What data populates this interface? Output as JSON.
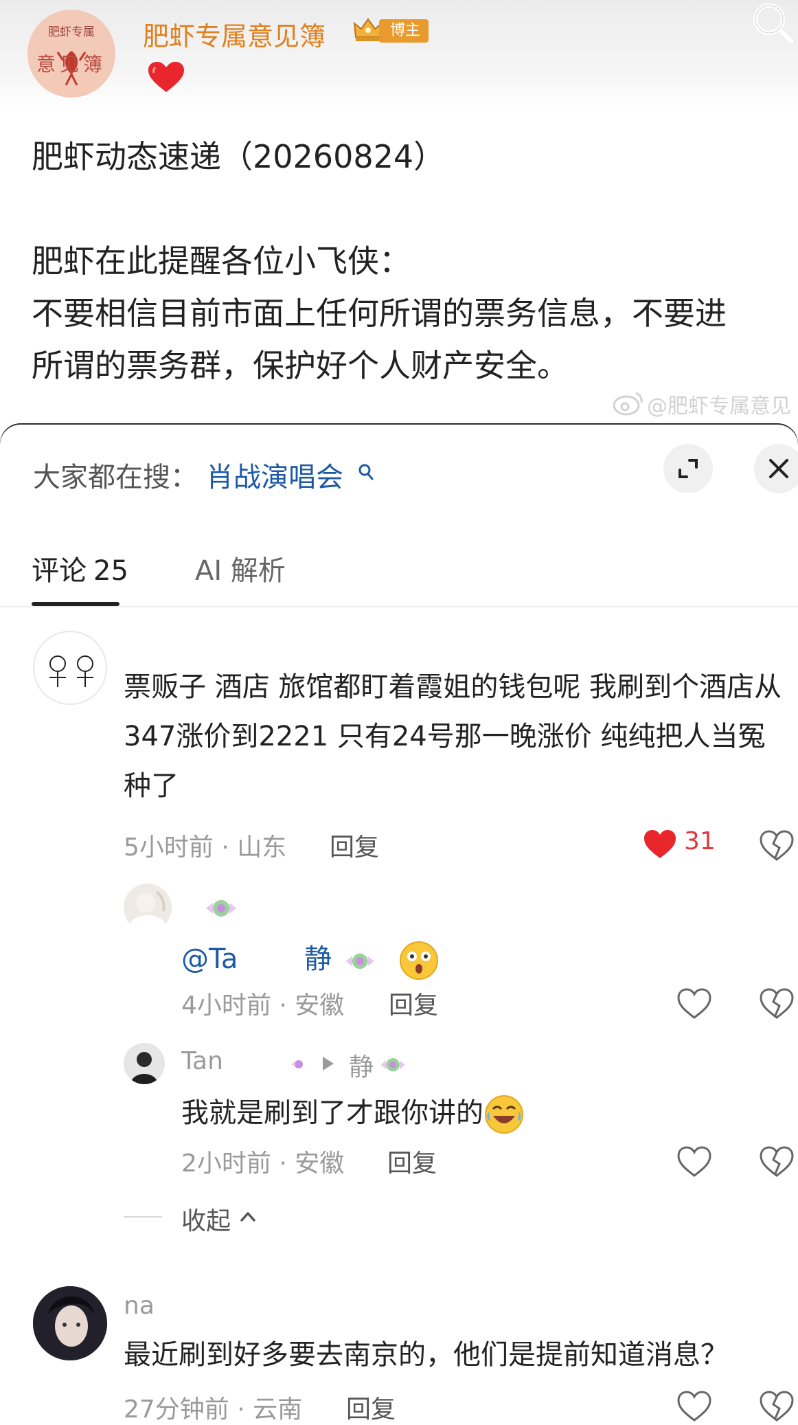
{
  "post": {
    "blogger_name": "肥虾专属意见簿",
    "badge": "博主",
    "avatar_line1": "肥虾专属",
    "avatar_line2": "意见簿",
    "text": "肥虾动态速递（20260824）\n\n肥虾在此提醒各位小飞侠：\n不要相信目前市面上任何所谓的票务信息，不要进\n所谓的票务群，保护好个人财产安全。",
    "watermark": "@肥虾专属意见"
  },
  "sheet": {
    "trend_label": "大家都在搜：",
    "trend_query": "肖战演唱会",
    "tab_comments": "评论",
    "tab_comments_count": "25",
    "tab_ai": "AI 解析"
  },
  "comments": [
    {
      "text": "票贩子 酒店 旅馆都盯着霞姐的钱包呢 我刷到个酒店从347涨价到2221 只有24号那一晚涨价 纯纯把人当冤种了",
      "meta": "5小时前 · 山东",
      "reply_label": "回复",
      "likes": "31"
    },
    {
      "mention": "@Ta",
      "mention_tail": "静",
      "meta": "4小时前 · 安徽",
      "reply_label": "回复"
    },
    {
      "name": "Tan",
      "reply_to": "静",
      "text": "我就是刷到了才跟你讲的",
      "meta": "2小时前 · 安徽",
      "reply_label": "回复"
    },
    {
      "name": "na",
      "text": "最近刷到好多要去南京的，他们是提前知道消息？",
      "meta": "27分钟前 · 云南",
      "reply_label": "回复"
    }
  ],
  "collapse_label": "收起",
  "colors": {
    "blogger_name": "#e0801f",
    "badge_bg": "#e89a2c",
    "link_blue": "#1d5aa6",
    "like_red": "#e2383f"
  }
}
